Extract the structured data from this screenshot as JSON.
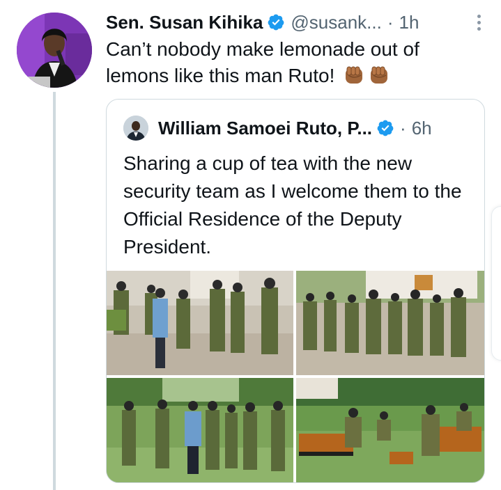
{
  "tweet": {
    "author_name": "Sen. Susan Kihika",
    "handle": "@susank...",
    "separator": "·",
    "time": "1h",
    "text": "Can’t nobody make lemonade out of lemons like this man Ruto!",
    "emoji": [
      "fist-icon",
      "fist-icon"
    ]
  },
  "quoted": {
    "author_name": "William Samoei Ruto, P...",
    "separator": "·",
    "time": "6h",
    "text": "Sharing a cup of tea with the new security team as I welcome them to the Official Residence of the Deputy President."
  },
  "colors": {
    "verified": "#1d9bf0",
    "text_primary": "#0f1419",
    "text_secondary": "#536471",
    "border": "#cfd9de",
    "avatar_bg": "#8a3fc0"
  }
}
